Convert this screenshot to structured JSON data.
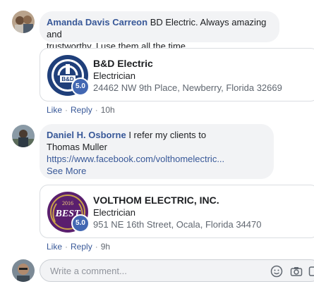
{
  "comments": [
    {
      "author": "Amanda Davis Carreon",
      "text_lines": [
        "BD Electric. Always amazing and",
        "trustworthy. I use them all the time."
      ],
      "card": {
        "name": "B&D Electric",
        "category": "Electrician",
        "address": "24462 NW 9th Place, Newberry, Florida 32669",
        "rating": "5.0"
      },
      "actions": {
        "like": "Like",
        "reply": "Reply",
        "time": "10h"
      }
    },
    {
      "author": "Daniel H. Osborne",
      "text_lines": [
        "I refer my clients to",
        "Thomas Muller"
      ],
      "link": "https://www.facebook.com/volthomelectric...",
      "see_more": "See More",
      "card": {
        "name": "VOLTHOM ELECTRIC, INC.",
        "category": "Electrician",
        "address": "951 NE 16th Street, Ocala, Florida 34470",
        "rating": "5.0",
        "logo_text": "BEST",
        "logo_year": "2016"
      },
      "actions": {
        "like": "Like",
        "reply": "Reply",
        "time": "9h"
      }
    }
  ],
  "composer": {
    "placeholder": "Write a comment...",
    "icons": [
      "emoji-icon",
      "camera-icon",
      "gif-icon"
    ]
  }
}
